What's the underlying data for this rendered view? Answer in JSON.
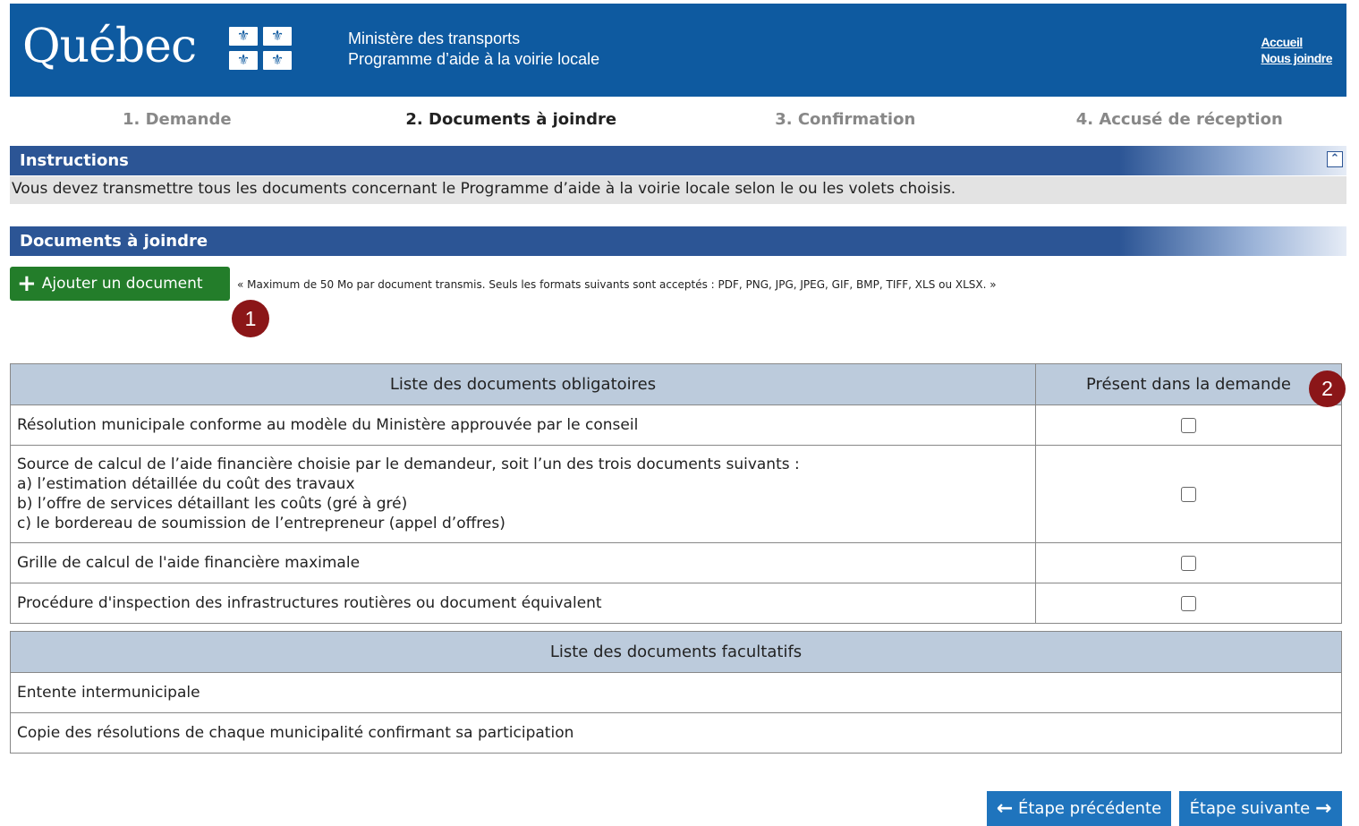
{
  "header": {
    "logo_text": "Québec",
    "ministry_line1": "Ministère des transports",
    "ministry_line2": "Programme d’aide à la voirie locale",
    "links": [
      "Accueil",
      "Nous joindre"
    ]
  },
  "steps": [
    {
      "label": "1. Demande",
      "active": false
    },
    {
      "label": "2. Documents à joindre",
      "active": true
    },
    {
      "label": "3. Confirmation",
      "active": false
    },
    {
      "label": "4. Accusé de réception",
      "active": false
    }
  ],
  "instructions": {
    "title": "Instructions",
    "text": "Vous devez transmettre tous les documents concernant le Programme d’aide à la voirie locale selon le ou les volets choisis."
  },
  "documents": {
    "title": "Documents à joindre",
    "add_button": "Ajouter un document",
    "note": "« Maximum de 50 Mo par document transmis. Seuls les formats suivants sont acceptés : PDF, PNG, JPG, JPEG, GIF, BMP, TIFF, XLS ou XLSX. »",
    "badge1": "1",
    "badge2": "2"
  },
  "table": {
    "mandatory_header": "Liste des documents obligatoires",
    "present_header": "Présent dans la demande",
    "mandatory": [
      {
        "lines": [
          "Résolution municipale conforme au modèle du Ministère approuvée par le conseil"
        ],
        "present": false
      },
      {
        "lines": [
          "Source de calcul de l’aide financière choisie par le demandeur, soit l’un des trois documents suivants :",
          "a) l’estimation détaillée du coût des travaux",
          "b) l’offre de services détaillant les coûts (gré à gré)",
          "c) le bordereau de soumission de l’entrepreneur (appel d’offres)"
        ],
        "present": false
      },
      {
        "lines": [
          "Grille de calcul de l'aide financière maximale"
        ],
        "present": false
      },
      {
        "lines": [
          "Procédure d'inspection des infrastructures routières ou document équivalent"
        ],
        "present": false
      }
    ],
    "optional_header": "Liste des documents facultatifs",
    "optional": [
      "Entente intermunicipale",
      "Copie des résolutions de chaque municipalité confirmant sa participation"
    ]
  },
  "nav": {
    "previous": "Étape précédente",
    "next": "Étape suivante"
  },
  "colors": {
    "header_blue": "#0e5aa0",
    "section_bar": "#2c5595",
    "add_button_green": "#237d2a",
    "nav_button_blue": "#1f74bd",
    "badge_red": "#8b1618"
  }
}
